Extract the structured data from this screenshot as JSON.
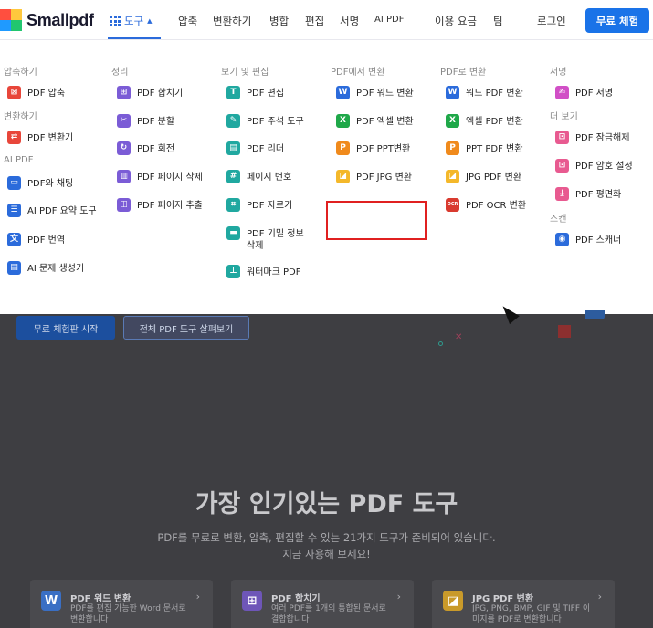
{
  "header": {
    "brand": "Smallpdf",
    "nav": {
      "tools": "도구",
      "compress": "압축",
      "convert": "변환하기",
      "merge": "병합",
      "edit": "편집",
      "sign": "서명",
      "ai_pdf": "AI PDF",
      "pricing": "이용 요금",
      "team": "팀",
      "login": "로그인",
      "cta": "무료 체험"
    }
  },
  "menu": {
    "col1": {
      "head_compress": "압축하기",
      "compress_pdf": "PDF 압축",
      "head_convert": "변환하기",
      "convert_pdf": "PDF 변환기",
      "head_ai": "AI PDF",
      "chat_pdf": "PDF와 채팅",
      "ai_summary": "AI PDF 요약 도구",
      "translate_pdf": "PDF 번역",
      "ai_question": "AI 문제 생성기"
    },
    "col2": {
      "head": "정리",
      "merge_pdf": "PDF 합치기",
      "split_pdf": "PDF 분할",
      "rotate_pdf": "PDF 회전",
      "delete_pages": "PDF 페이지 삭제",
      "extract_pages": "PDF 페이지 추출"
    },
    "col3": {
      "head": "보기 및 편집",
      "edit_pdf": "PDF 편집",
      "annotate_pdf": "PDF 주석 도구",
      "pdf_reader": "PDF 리더",
      "page_numbers": "페이지 번호",
      "crop_pdf": "PDF 자르기",
      "redact_line1": "PDF 기밀 정보",
      "redact_line2": "삭제",
      "watermark": "워터마크 PDF"
    },
    "col4": {
      "head": "PDF에서 변환",
      "pdf_to_word": "PDF 워드 변환",
      "pdf_to_excel": "PDF 엑셀 변환",
      "pdf_to_ppt": "PDF PPT변환",
      "pdf_to_jpg": "PDF JPG 변환"
    },
    "col5": {
      "head": "PDF로 변환",
      "word_to_pdf": "워드 PDF 변환",
      "excel_to_pdf": "엑셀 PDF 변환",
      "ppt_to_pdf": "PPT PDF 변환",
      "jpg_to_pdf": "JPG PDF 변환",
      "pdf_ocr": "PDF OCR 변환"
    },
    "col6": {
      "head_sign": "서명",
      "sign_pdf": "PDF 서명",
      "head_more": "더 보기",
      "unlock_pdf": "PDF 잠금해제",
      "protect_pdf": "PDF 암호 설정",
      "flatten_pdf": "PDF 평면화",
      "head_scan": "스캔",
      "pdf_scanner": "PDF 스캐너"
    }
  },
  "hero": {
    "free_trial_button": "무료 체험판 시작",
    "all_tools_button": "전체 PDF 도구 살펴보기"
  },
  "popular": {
    "title": "가장 인기있는 PDF 도구",
    "subtitle_line1": "PDF를 무료로 변환, 압축, 편집할 수 있는 21가지 도구가 준비되어 있습니다.",
    "subtitle_line2": "지금 사용해 보세요!",
    "cards": [
      {
        "title": "PDF 워드 변환",
        "desc": "PDF를 편집 가능한 Word 문서로 변환합니다"
      },
      {
        "title": "PDF 합치기",
        "desc": "여러 PDF를 1개의 통합된 문서로 결합합니다"
      },
      {
        "title": "JPG PDF 변환",
        "desc": "JPG, PNG, BMP, GIF 및 TIFF 이미지를 PDF로 변환합니다"
      }
    ]
  },
  "colors": {
    "accent": "#1a73e8",
    "highlight_box": "#e02020"
  }
}
